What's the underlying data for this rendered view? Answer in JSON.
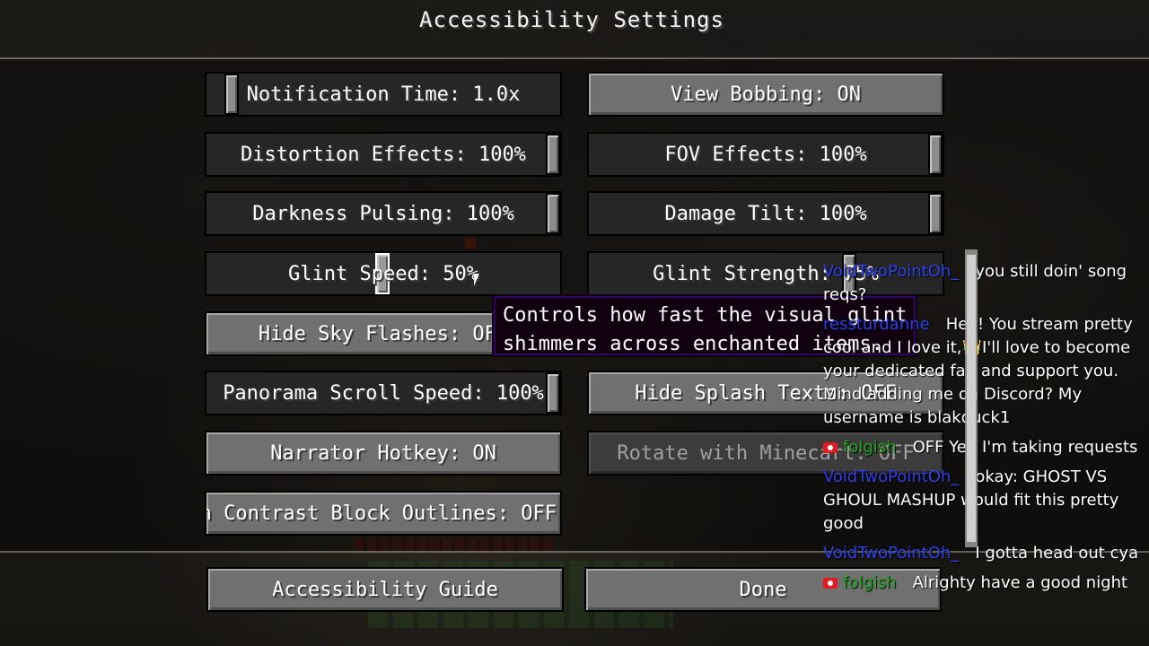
{
  "screen": {
    "title": "Accessibility Settings"
  },
  "options": {
    "notification_time": {
      "label": "Notification Time: 1.0x",
      "value": 0.05
    },
    "view_bobbing": {
      "label": "View Bobbing: ON"
    },
    "distortion_effects": {
      "label": "Distortion Effects: 100%",
      "value": 1.0
    },
    "fov_effects": {
      "label": "FOV Effects: 100%",
      "value": 1.0
    },
    "darkness_pulsing": {
      "label": "Darkness Pulsing: 100%",
      "value": 1.0
    },
    "damage_tilt": {
      "label": "Damage Tilt: 100%",
      "value": 1.0
    },
    "glint_speed": {
      "label": "Glint Speed: 50%",
      "value": 0.5
    },
    "glint_strength": {
      "label": "Glint Strength: 75%"
    },
    "hide_sky_flashes": {
      "label": "Hide Sky Flashes: OFF"
    },
    "panorama_scroll_speed": {
      "label": "Panorama Scroll Speed: 100%",
      "value": 1.0
    },
    "hide_splash_texts": {
      "label": "Hide Splash Texts: OFF"
    },
    "narrator_hotkey": {
      "label": "Narrator Hotkey: ON"
    },
    "rotate_with_minecart": {
      "label": "Rotate with Minecart: OFF"
    },
    "high_contrast_outlines": {
      "label": "High Contrast Block Outlines: OFF"
    }
  },
  "tooltip": {
    "line1": "Controls how fast the visual glint",
    "line2": "shimmers across enchanted items."
  },
  "footer": {
    "guide_label": "Accessibility Guide",
    "done_label": "Done"
  },
  "chat": {
    "messages": [
      {
        "user": "VoidTwoPointOh_",
        "text": "you still doin' song reqs?"
      },
      {
        "user": "ressturdanne",
        "text": "Hey! You stream pretty cool and I love it,",
        "emoji": "👑",
        "text2": "I'll love to become your dedicated fan and support you. Mind adding me on Discord? My username is blakduck1"
      },
      {
        "user": "folgish",
        "text": "OFF Yep I'm taking requests"
      },
      {
        "user": "VoidTwoPointOh_",
        "text": "okay: GHOST VS GHOUL MASHUP would fit this pretty good"
      },
      {
        "user": "VoidTwoPointOh_",
        "text": "I gotta head out cya"
      },
      {
        "user": "folgish",
        "text": "Alrighty have a good night"
      }
    ]
  },
  "colors": {
    "username_blue": "#2f3fe8",
    "username_green": "#22a322",
    "tooltip_border": "#2a0a5e"
  }
}
